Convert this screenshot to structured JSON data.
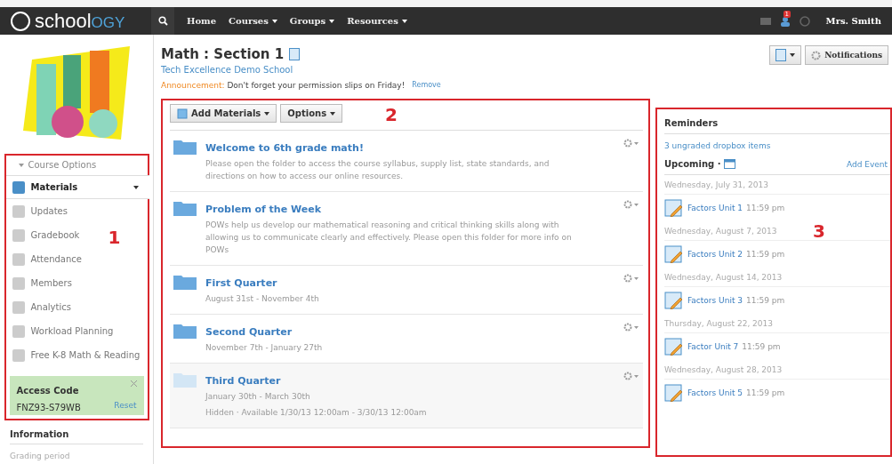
{
  "topbar": {
    "logo_main": "school",
    "logo_accent": "OGY",
    "nav": [
      {
        "label": "Home",
        "dropdown": false
      },
      {
        "label": "Courses",
        "dropdown": true
      },
      {
        "label": "Groups",
        "dropdown": true
      },
      {
        "label": "Resources",
        "dropdown": true
      }
    ],
    "badge": "1",
    "user": "Mrs. Smith"
  },
  "sidebar": {
    "annotation": "1",
    "course_options": "Course Options",
    "items": [
      {
        "label": "Materials",
        "selected": true
      },
      {
        "label": "Updates",
        "selected": false
      },
      {
        "label": "Gradebook",
        "selected": false
      },
      {
        "label": "Attendance",
        "selected": false
      },
      {
        "label": "Members",
        "selected": false
      },
      {
        "label": "Analytics",
        "selected": false
      },
      {
        "label": "Workload Planning",
        "selected": false
      },
      {
        "label": "Free K-8 Math & Reading",
        "selected": false
      }
    ],
    "access_code": {
      "title": "Access Code",
      "code": "FNZ93-S79WB",
      "reset": "Reset"
    },
    "information": "Information",
    "grading_period": "Grading period"
  },
  "header": {
    "title": "Math : Section 1",
    "school": "Tech Excellence Demo School",
    "announcement_label": "Announcement:",
    "announcement": "Don't forget your permission slips on Friday!",
    "remove": "Remove",
    "notifications": "Notifications"
  },
  "materials": {
    "annotation": "2",
    "buttons": [
      "Add Materials",
      "Options"
    ],
    "items": [
      {
        "title": "Welcome to 6th grade math!",
        "description": "Please open the folder to access the course syllabus, supply list, state standards, and directions on how to access our online resources.",
        "hidden": false
      },
      {
        "title": "Problem of the Week",
        "description": "POWs help us develop our mathematical reasoning and critical thinking skills along with allowing us to communicate clearly and effectively. Please open this folder for more info on POWs",
        "hidden": false
      },
      {
        "title": "First Quarter",
        "description": "August 31st - November 4th",
        "hidden": false
      },
      {
        "title": "Second Quarter",
        "description": "November 7th - January 27th",
        "hidden": false
      },
      {
        "title": "Third Quarter",
        "description": "January 30th - March 30th",
        "hidden": true,
        "status": "Hidden · Available 1/30/13 12:00am - 3/30/13 12:00am"
      }
    ]
  },
  "right": {
    "annotation": "3",
    "reminders": "Reminders",
    "reminder_link": "3 ungraded dropbox items",
    "upcoming": "Upcoming ·",
    "add_event": "Add Event",
    "events": [
      {
        "date": "Wednesday, July 31, 2013",
        "title": "Factors Unit 1",
        "time": "11:59 pm"
      },
      {
        "date": "Wednesday, August 7, 2013",
        "title": "Factors Unit 2",
        "time": "11:59 pm"
      },
      {
        "date": "Wednesday, August 14, 2013",
        "title": "Factors Unit 3",
        "time": "11:59 pm"
      },
      {
        "date": "Thursday, August 22, 2013",
        "title": "Factor Unit 7",
        "time": "11:59 pm"
      },
      {
        "date": "Wednesday, August 28, 2013",
        "title": "Factors Unit 5",
        "time": "11:59 pm"
      }
    ]
  }
}
